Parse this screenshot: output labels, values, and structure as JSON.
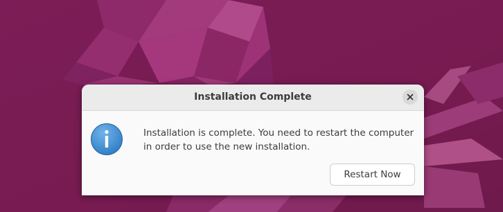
{
  "dialog": {
    "title": "Installation Complete",
    "message_line1": "Installation is complete. You need to restart the computer",
    "message_line2": "in order to use the new installation.",
    "primary_button_label": "Restart Now",
    "icon": "info-icon",
    "close_icon": "close-icon"
  },
  "colors": {
    "wallpaper_base": "#7a1f55",
    "wallpaper_accent": "#a8357a",
    "dialog_bg": "#fafafa",
    "titlebar_bg": "#ebebeb",
    "info_icon_blue": "#3d8fd6",
    "text": "#3c3c3c"
  }
}
